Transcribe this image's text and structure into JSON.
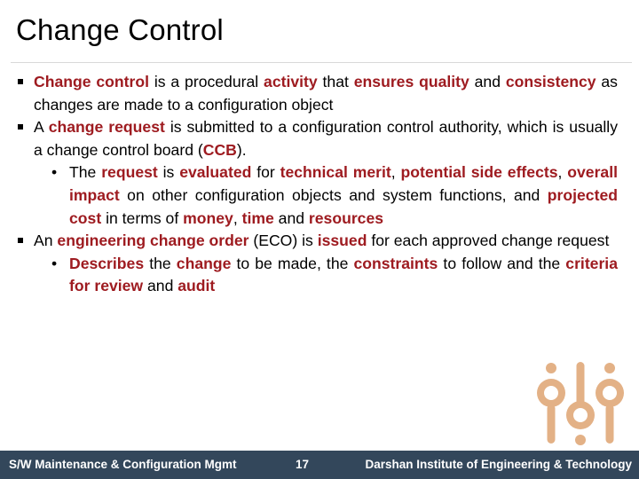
{
  "slide": {
    "title": "Change Control",
    "bullet_glyph_level1": "square",
    "bullet_glyph_level2": "•",
    "accent_color": "#9E1B20",
    "text_color": "#000000",
    "footer_bg_color": "#33475B",
    "footer_text_color": "#FFFFFF",
    "logo_color": "#E3B186",
    "divider_color": "#D9D9D9"
  },
  "content": {
    "items": [
      {
        "level": 1,
        "runs": [
          {
            "text": "Change control",
            "emphasis": true
          },
          {
            "text": " is a procedural ",
            "emphasis": false
          },
          {
            "text": "activity",
            "emphasis": true
          },
          {
            "text": " that ",
            "emphasis": false
          },
          {
            "text": "ensures quality",
            "emphasis": true
          },
          {
            "text": " and ",
            "emphasis": false
          },
          {
            "text": "consistency",
            "emphasis": true
          },
          {
            "text": " as changes are made to a configuration object",
            "emphasis": false
          }
        ]
      },
      {
        "level": 1,
        "runs": [
          {
            "text": "A ",
            "emphasis": false
          },
          {
            "text": "change request",
            "emphasis": true
          },
          {
            "text": " is submitted to a configuration control authority, which is usually a change control board (",
            "emphasis": false
          },
          {
            "text": "CCB",
            "emphasis": true
          },
          {
            "text": ").",
            "emphasis": false
          }
        ]
      },
      {
        "level": 2,
        "runs": [
          {
            "text": "The ",
            "emphasis": false
          },
          {
            "text": "request",
            "emphasis": true
          },
          {
            "text": " is ",
            "emphasis": false
          },
          {
            "text": "evaluated",
            "emphasis": true
          },
          {
            "text": " for ",
            "emphasis": false
          },
          {
            "text": "technical merit",
            "emphasis": true
          },
          {
            "text": ", ",
            "emphasis": false
          },
          {
            "text": "potential side effects",
            "emphasis": true
          },
          {
            "text": ", ",
            "emphasis": false
          },
          {
            "text": "overall impact",
            "emphasis": true
          },
          {
            "text": " on other configuration objects and system functions, and ",
            "emphasis": false
          },
          {
            "text": "projected cost",
            "emphasis": true
          },
          {
            "text": " in terms of ",
            "emphasis": false
          },
          {
            "text": "money",
            "emphasis": true
          },
          {
            "text": ", ",
            "emphasis": false
          },
          {
            "text": "time",
            "emphasis": true
          },
          {
            "text": " and ",
            "emphasis": false
          },
          {
            "text": "resources",
            "emphasis": true
          }
        ]
      },
      {
        "level": 1,
        "runs": [
          {
            "text": "An ",
            "emphasis": false
          },
          {
            "text": "engineering change order",
            "emphasis": true
          },
          {
            "text": " (ECO) is ",
            "emphasis": false
          },
          {
            "text": "issued",
            "emphasis": true
          },
          {
            "text": " for each approved change request",
            "emphasis": false
          }
        ]
      },
      {
        "level": 2,
        "runs": [
          {
            "text": "Describes",
            "emphasis": true
          },
          {
            "text": " the ",
            "emphasis": false
          },
          {
            "text": "change",
            "emphasis": true
          },
          {
            "text": " to be made, the ",
            "emphasis": false
          },
          {
            "text": "constraints",
            "emphasis": true
          },
          {
            "text": " to follow and the ",
            "emphasis": false
          },
          {
            "text": "criteria for review",
            "emphasis": true
          },
          {
            "text": " and ",
            "emphasis": false
          },
          {
            "text": "audit",
            "emphasis": true
          }
        ]
      }
    ]
  },
  "footer": {
    "course": "S/W Maintenance & Configuration Mgmt",
    "page_number": "17",
    "institute": "Darshan Institute of Engineering & Technology"
  }
}
